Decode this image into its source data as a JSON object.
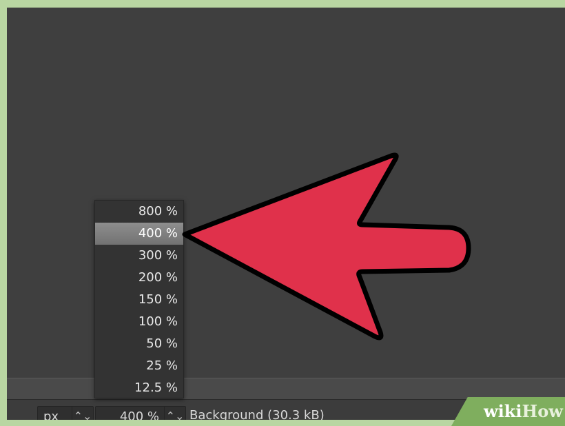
{
  "status_bar": {
    "unit_value": "px",
    "zoom_value": "400 %",
    "layer_info": "Background (30.3 kB)"
  },
  "zoom_menu": {
    "options": [
      "800 %",
      "400 %",
      "300 %",
      "200 %",
      "150 %",
      "100 %",
      "50 %",
      "25 %",
      "12.5 %"
    ],
    "selected": "400 %"
  },
  "watermark": {
    "part1": "wiki",
    "part2": "How"
  },
  "colors": {
    "frame": "#b9d6a2",
    "canvas": "#3f3f3f",
    "arrow_fill": "#e0314b",
    "selected_item": "#8a8a8a"
  },
  "icons": {
    "spinner": "up-down-chevron-icon",
    "annotation": "red-pointer-arrow-icon"
  }
}
